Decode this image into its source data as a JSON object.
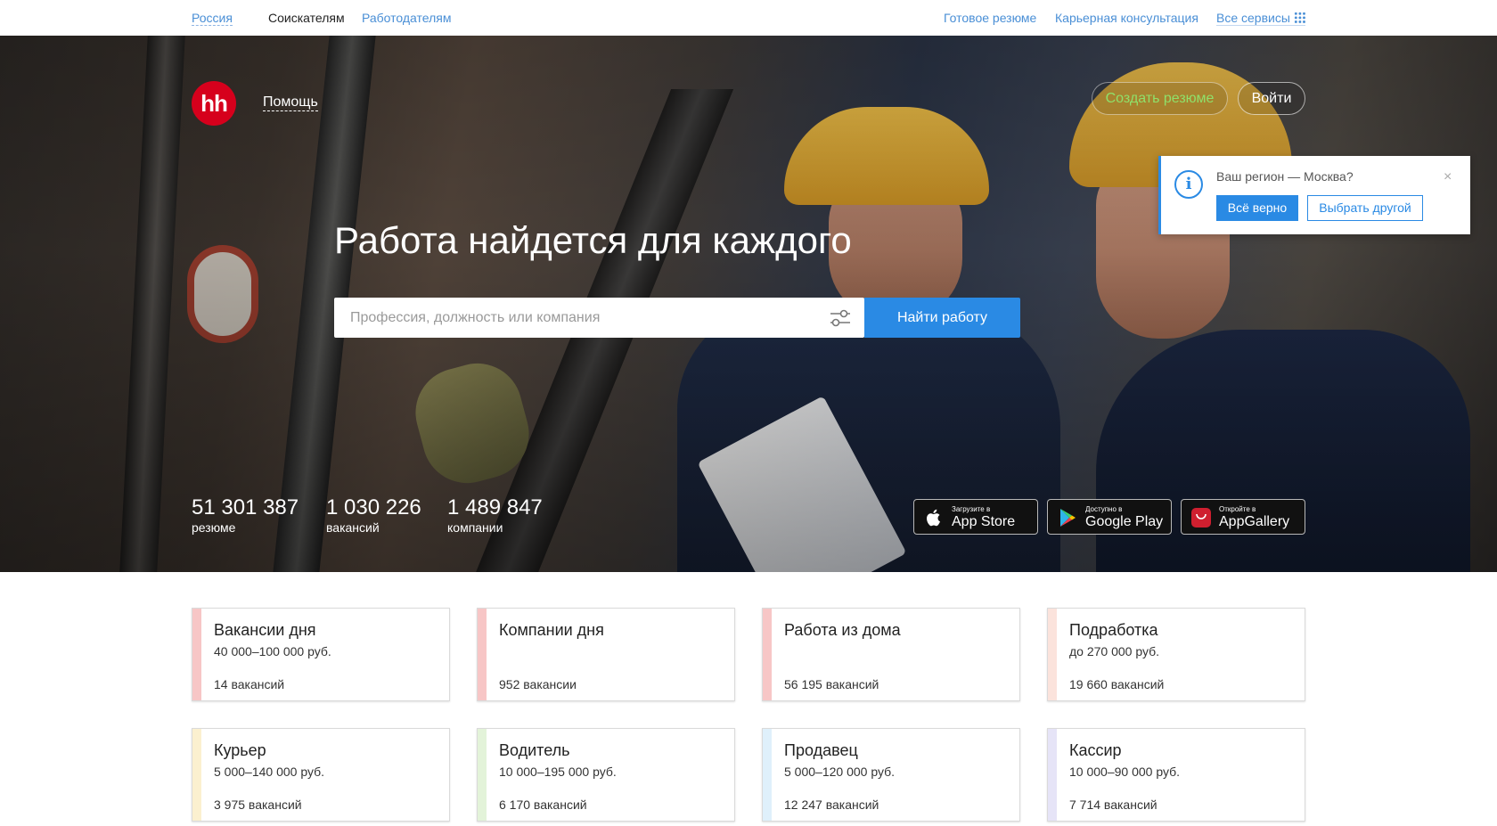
{
  "topbar": {
    "region": "Россия",
    "seekers": "Соискателям",
    "employers": "Работодателям",
    "ready_resume": "Готовое резюме",
    "career": "Карьерная консультация",
    "all_services": "Все сервисы"
  },
  "header": {
    "logo": "hh",
    "help": "Помощь",
    "create_resume": "Создать резюме",
    "login": "Войти"
  },
  "hero": {
    "title": "Работа найдется для каждого",
    "search_placeholder": "Профессия, должность или компания",
    "search_button": "Найти работу"
  },
  "stats": [
    {
      "num": "51 301 387",
      "label": "резюме"
    },
    {
      "num": "1 030 226",
      "label": "вакансий"
    },
    {
      "num": "1 489 847",
      "label": "компании"
    }
  ],
  "apps": [
    {
      "small": "Загрузите в",
      "big": "App Store",
      "icon": "apple-icon"
    },
    {
      "small": "Доступно в",
      "big": "Google Play",
      "icon": "google-play-icon"
    },
    {
      "small": "Откройте в",
      "big": "AppGallery",
      "icon": "huawei-icon"
    }
  ],
  "region_popup": {
    "question": "Ваш регион — Москва?",
    "confirm": "Всё верно",
    "choose_other": "Выбрать другой",
    "close": "×"
  },
  "cards": [
    {
      "title": "Вакансии дня",
      "salary": "40 000–100 000 руб.",
      "count": "14 вакансий",
      "accent": "#f7c6c6"
    },
    {
      "title": "Компании дня",
      "salary": "",
      "count": "952 вакансии",
      "accent": "#f7c6c6"
    },
    {
      "title": "Работа из дома",
      "salary": "",
      "count": "56 195 вакансий",
      "accent": "#f7c6c6"
    },
    {
      "title": "Подработка",
      "salary": "до 270 000 руб.",
      "count": "19 660 вакансий",
      "accent": "#fbe3dc"
    },
    {
      "title": "Курьер",
      "salary": "5 000–140 000 руб.",
      "count": "3 975 вакансий",
      "accent": "#fbf0cf"
    },
    {
      "title": "Водитель",
      "salary": "10 000–195 000 руб.",
      "count": "6 170 вакансий",
      "accent": "#e3f3d9"
    },
    {
      "title": "Продавец",
      "salary": "5 000–120 000 руб.",
      "count": "12 247 вакансий",
      "accent": "#dff0fb"
    },
    {
      "title": "Кассир",
      "salary": "10 000–90 000 руб.",
      "count": "7 714 вакансий",
      "accent": "#e6e4f7"
    }
  ],
  "colors": {
    "brand": "#d6001c",
    "accent_blue": "#2a8ae4",
    "create_green": "#8fe06a"
  }
}
